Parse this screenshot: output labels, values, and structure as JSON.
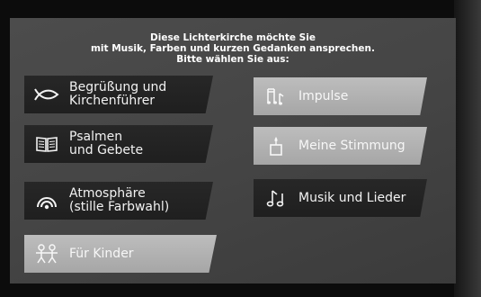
{
  "header": {
    "line1": "Diese Lichterkirche möchte Sie",
    "line2": "mit Musik, Farben und kurzen Gedanken ansprechen.",
    "line3": "Bitte wählen Sie aus:"
  },
  "left_buttons": [
    {
      "lines": [
        "Begrüßung und",
        "Kirchenführer"
      ],
      "icon": "fish-icon"
    },
    {
      "lines": [
        "Psalmen",
        "und Gebete"
      ],
      "icon": "book-icon"
    },
    {
      "lines": [
        "Atmosphäre",
        "(stille Farbwahl)"
      ],
      "icon": "broadcast-waves-icon"
    },
    {
      "lines": [
        "Für Kinder"
      ],
      "icon": "children-icon"
    }
  ],
  "right_buttons": [
    {
      "lines": [
        "Impulse"
      ],
      "icon": "music-notes-icon"
    },
    {
      "lines": [
        "Meine Stimmung"
      ],
      "icon": "candle-icon"
    },
    {
      "lines": [
        "Musik und Lieder"
      ],
      "icon": "music-notes-icon"
    }
  ],
  "colors": {
    "screen_background": "#444444",
    "dark_tile": "#242424",
    "light_tile": "#b0b0b0",
    "text": "#ffffff"
  }
}
